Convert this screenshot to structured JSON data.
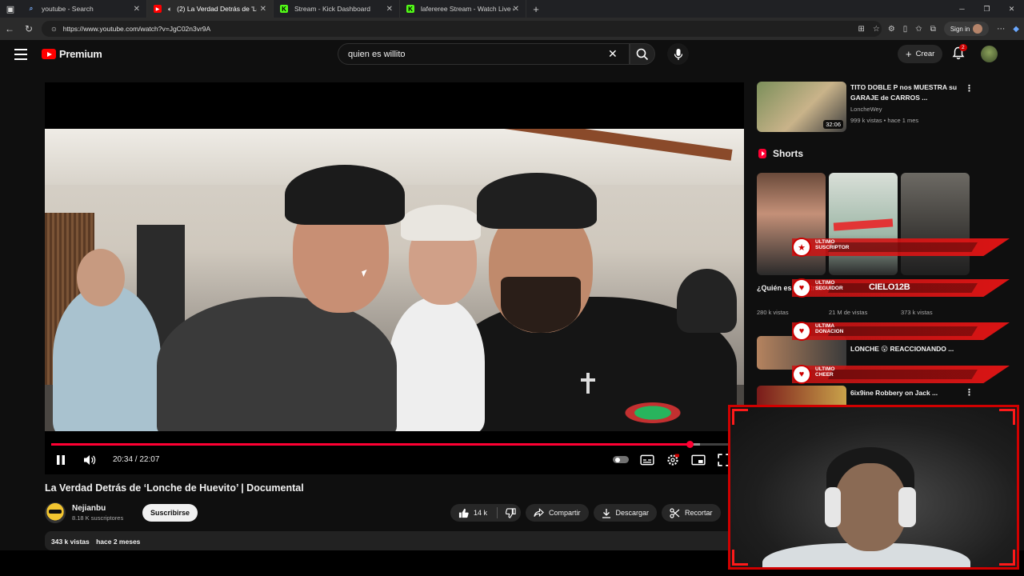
{
  "browser": {
    "tabs": [
      {
        "title": "youtube - Search",
        "active": false,
        "favicon": "search-icon"
      },
      {
        "title": "(2) La Verdad Detrás de 'Lon",
        "active": true,
        "favicon": "youtube-icon"
      },
      {
        "title": "Stream - Kick Dashboard",
        "active": false,
        "favicon": "kick-icon"
      },
      {
        "title": "lafereree Stream - Watch Live on",
        "active": false,
        "favicon": "kick-icon"
      }
    ],
    "url": "https://www.youtube.com/watch?v=JgC02n3vr9A",
    "signin_label": "Sign in"
  },
  "youtube": {
    "brand": "Premium",
    "search_query": "quien es willito",
    "create_label": "Crear",
    "notification_count": "2"
  },
  "player": {
    "time_current": "20:34",
    "time_total": "22:07",
    "time_display": "20:34 / 22:07",
    "progress": 0.93,
    "buffered": 0.945,
    "accent_color": "#ff0033"
  },
  "video": {
    "title": "La Verdad Detrás de ‘Lonche de Huevito’ | Documental",
    "channel": "Nejianbu",
    "subscribers": "8.18 K suscriptores",
    "subscribe_label": "Suscribirse",
    "likes": "14 k",
    "share_label": "Compartir",
    "download_label": "Descargar",
    "clip_label": "Recortar",
    "views": "343 k vistas",
    "published": "hace 2 meses"
  },
  "sidebar": {
    "top_rec": {
      "title": "TITO DOBLE P nos MUESTRA su GARAJE de CARROS ...",
      "channel": "LoncheWey",
      "meta": "999 k vistas • hace 1 mes",
      "duration": "32:06"
    },
    "shorts_label": "Shorts",
    "shorts": [
      {
        "title": "¿Quién es ... detrás",
        "views": "280 k vistas"
      },
      {
        "title": "",
        "views": "21 M de vistas"
      },
      {
        "title": "",
        "views": "373 k vistas"
      }
    ],
    "list": [
      {
        "title": "LONCHE 😮 REACCIONANDO ..."
      },
      {
        "title": "6ix9ine Robbery on Jack ..."
      }
    ]
  },
  "overlay": {
    "alerts": [
      {
        "label_1": "ULTIMO",
        "label_2": "SUSCRIPTOR",
        "value": "",
        "icon": "star-icon"
      },
      {
        "label_1": "ULTIMO",
        "label_2": "SEGUIDOR",
        "value": "CIELO12B",
        "icon": "heart-icon"
      },
      {
        "label_1": "ULTIMA",
        "label_2": "DONACION",
        "value": "",
        "icon": "heart-icon"
      },
      {
        "label_1": "ULTIMO",
        "label_2": "CHEER",
        "value": "",
        "icon": "heart-icon"
      }
    ],
    "frame_color": "#d00000"
  }
}
